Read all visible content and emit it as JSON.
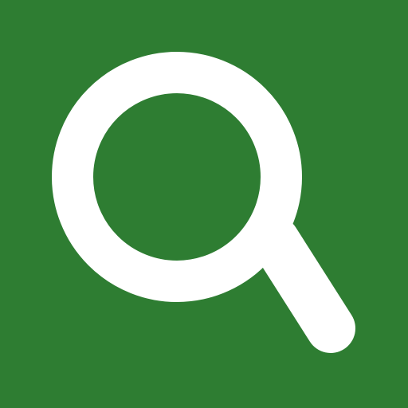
{
  "icon": {
    "name": "search-icon",
    "background_color": "#2E7D32",
    "foreground_color": "#FFFFFF"
  }
}
